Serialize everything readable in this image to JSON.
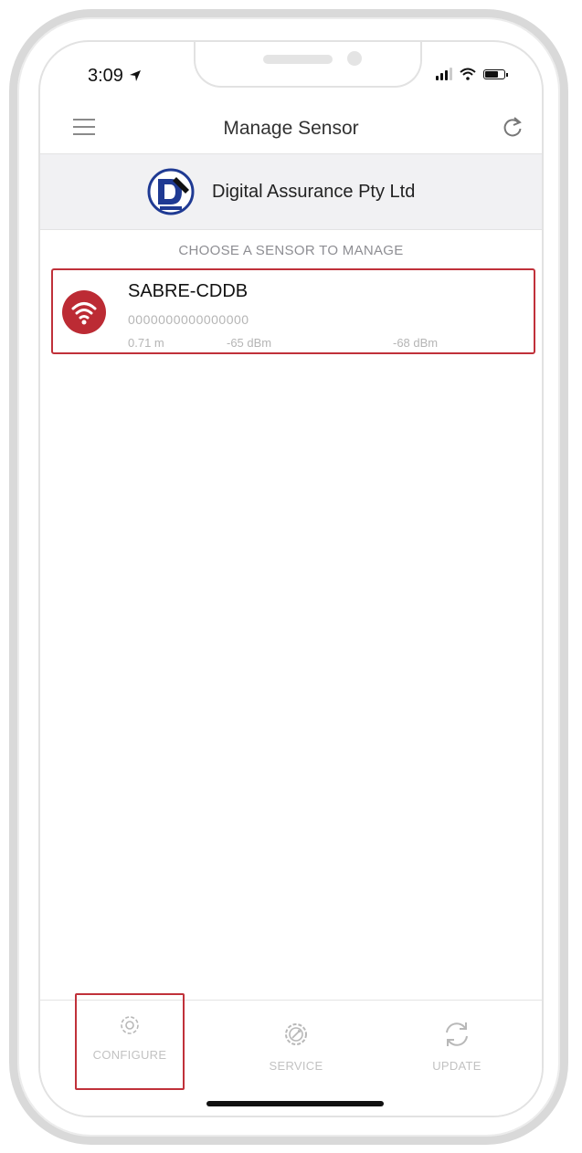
{
  "status_bar": {
    "time": "3:09"
  },
  "nav": {
    "title": "Manage Sensor",
    "menu_icon": "hamburger-menu-icon",
    "refresh_icon": "refresh-icon"
  },
  "organization": {
    "name": "Digital Assurance Pty Ltd"
  },
  "list": {
    "header": "CHOOSE A SENSOR TO MANAGE",
    "sensors": [
      {
        "name": "SABRE-CDDB",
        "id": "0000000000000000",
        "distance": "0.71 m",
        "rssi_1": "-65 dBm",
        "rssi_2": "-68 dBm",
        "icon": "wifi-icon"
      }
    ]
  },
  "tabs": [
    {
      "label": "CONFIGURE",
      "icon": "gear-icon"
    },
    {
      "label": "SERVICE",
      "icon": "service-gear-icon"
    },
    {
      "label": "UPDATE",
      "icon": "sync-icon"
    }
  ],
  "colors": {
    "accent": "#bc2b34",
    "highlight_border": "#c0313a",
    "muted_text": "#b5b5b5"
  }
}
